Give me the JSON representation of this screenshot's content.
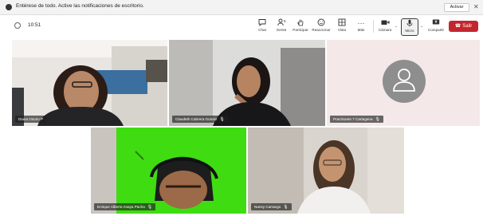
{
  "notification": {
    "message": "Entérese de todo. Active las notificaciones de escritorio.",
    "action_label": "Activar",
    "close_glyph": "✕"
  },
  "meeting": {
    "elapsed_time": "10:51"
  },
  "toolbar": {
    "chat_label": "Chat",
    "people_label": "Gente",
    "people_count": "5",
    "raise_hand_label": "Participar",
    "react_label": "Reaccionar",
    "view_label": "Vista",
    "more_label": "Más",
    "camera_label": "Cámara",
    "mic_label": "Micro",
    "share_label": "Compartir",
    "leave_label": "Salir"
  },
  "participants": [
    {
      "name": "Diana Osorio P",
      "muted": false
    },
    {
      "name": "Claudeth Cabrera Gomez",
      "muted": true
    },
    {
      "name": "Practicante 7 Cartagena",
      "muted": true
    },
    {
      "name": "Enrique Alberto Anaya Pacha",
      "muted": true
    },
    {
      "name": "Nansy Camargo",
      "muted": true
    }
  ],
  "colors": {
    "leave_button": "#c4262e",
    "green_screen": "#3fdc12",
    "avatar_tile_bg": "#f4e9e8",
    "avatar_circle": "#8e8e8e"
  },
  "icons": {
    "mic_muted": "mic-muted-icon",
    "avatar": "person-avatar-icon"
  }
}
